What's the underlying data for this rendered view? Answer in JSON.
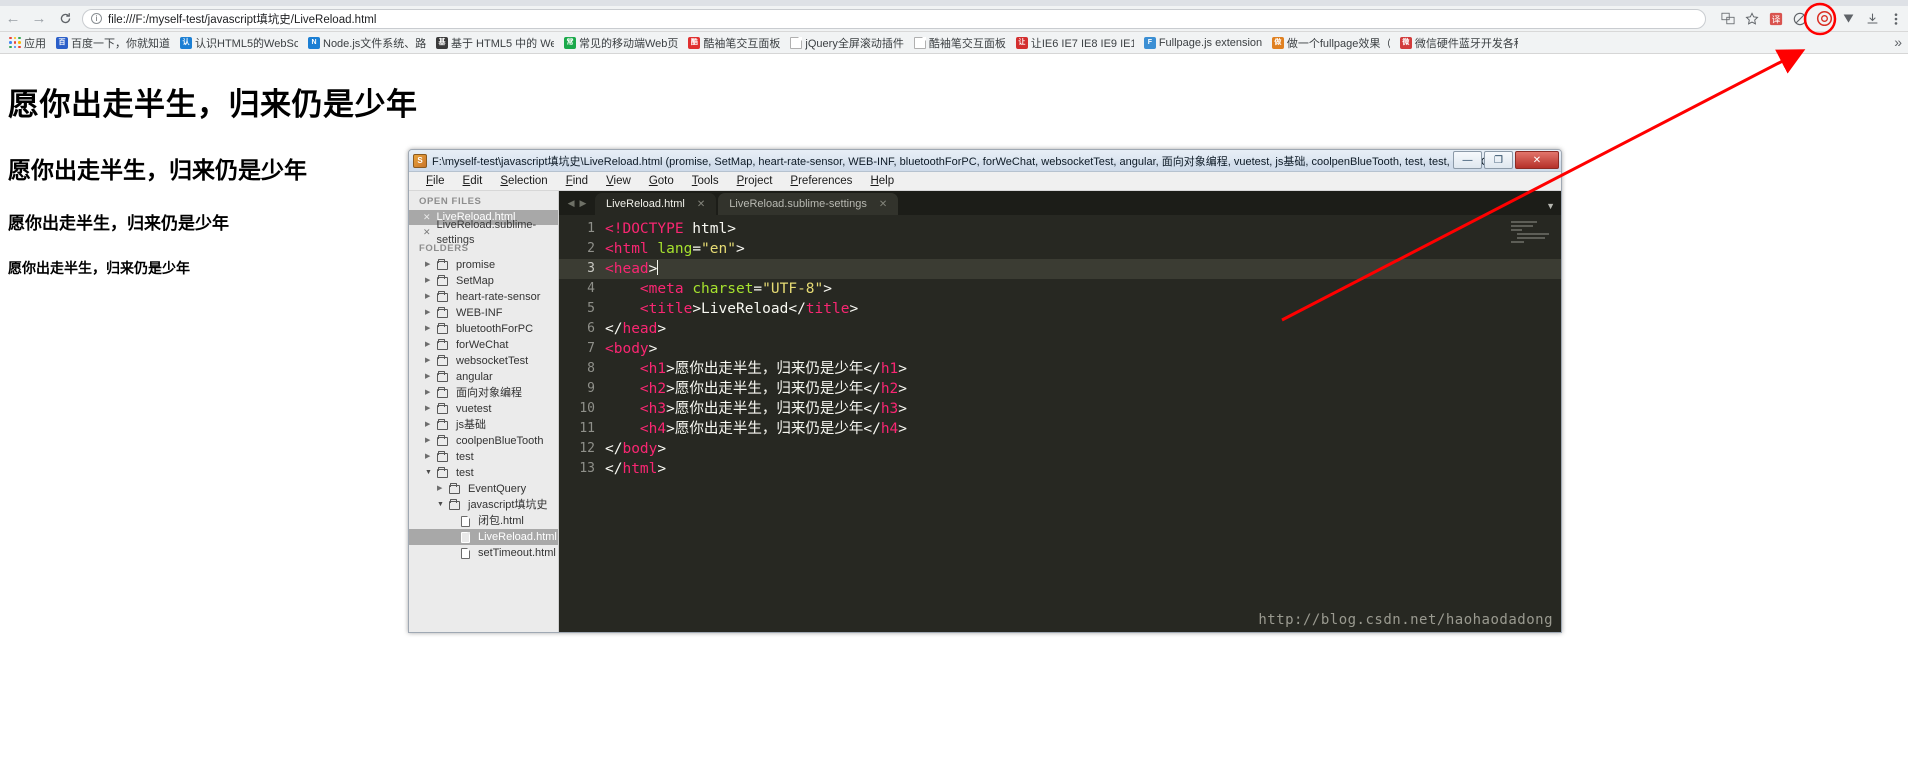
{
  "browser": {
    "back_icon": "←",
    "forward_icon": "→",
    "reload_icon": "C",
    "url": "file:///F:/myself-test/javascript填坑史/LiveReload.html",
    "info_icon": "i",
    "toolbar_icons": [
      "translate-icon",
      "star-icon",
      "extension-icon",
      "adblock-icon",
      "circle-icon",
      "lastpass-icon",
      "download-icon",
      "menu-icon"
    ],
    "overflow_label": "»"
  },
  "bookmarks": [
    {
      "label": "应用",
      "icon": "apps-grid-icon",
      "color": "#4285f4"
    },
    {
      "label": "百度一下，你就知道",
      "icon": "baidu-icon",
      "color": "#2b5fc9"
    },
    {
      "label": "认识HTML5的WebSc",
      "icon": "csdn-icon",
      "color": "#1b7fd4"
    },
    {
      "label": "Node.js文件系统、路",
      "icon": "csdn-icon",
      "color": "#1b7fd4"
    },
    {
      "label": "基于 HTML5 中的 We",
      "icon": "nav-icon",
      "color": "#3b3b3b"
    },
    {
      "label": "常见的移动端Web页",
      "icon": "c-green-icon",
      "color": "#1aa94a"
    },
    {
      "label": "酷袖笔交互面板",
      "icon": "b-red-icon",
      "color": "#e03030"
    },
    {
      "label": "jQuery全屏滚动插件",
      "icon": "page-icon",
      "color": "#ffffff"
    },
    {
      "label": "酷袖笔交互面板",
      "icon": "page-icon",
      "color": "#ffffff"
    },
    {
      "label": "让IE6 IE7 IE8 IE9 IE1",
      "icon": "c-red-icon",
      "color": "#d32f2f"
    },
    {
      "label": "Fullpage.js extension",
      "icon": "fullpage-icon",
      "color": "#3b8fd4"
    },
    {
      "label": "做一个fullpage效果（",
      "icon": "home-orange-icon",
      "color": "#e08020"
    },
    {
      "label": "微信硬件蓝牙开发各种",
      "icon": "wechat-dev-icon",
      "color": "#d23b3b"
    }
  ],
  "page": {
    "h1": "愿你出走半生，归来仍是少年",
    "h2": "愿你出走半生，归来仍是少年",
    "h3": "愿你出走半生，归来仍是少年",
    "h4": "愿你出走半生，归来仍是少年"
  },
  "sublime": {
    "title": "F:\\myself-test\\javascript填坑史\\LiveReload.html (promise, SetMap, heart-rate-sensor, WEB-INF, bluetoothForPC, forWeChat, websocketTest, angular, 面向对象编程, vuetest, js基础, coolpenBlueTooth, test, test, EventQuery, ...",
    "app_icon": "sublime-text-icon",
    "window_buttons": {
      "minimize": "—",
      "maximize": "❐",
      "close": "✕"
    },
    "menu": [
      "File",
      "Edit",
      "Selection",
      "Find",
      "View",
      "Goto",
      "Tools",
      "Project",
      "Preferences",
      "Help"
    ],
    "sidebar": {
      "open_files_header": "OPEN FILES",
      "open_files": [
        {
          "name": "LiveReload.html",
          "selected": true
        },
        {
          "name": "LiveReload.sublime-settings",
          "selected": false
        }
      ],
      "folders_header": "FOLDERS",
      "tree": [
        {
          "name": "promise",
          "type": "folder",
          "open": false,
          "depth": 1
        },
        {
          "name": "SetMap",
          "type": "folder",
          "open": false,
          "depth": 1
        },
        {
          "name": "heart-rate-sensor",
          "type": "folder",
          "open": false,
          "depth": 1
        },
        {
          "name": "WEB-INF",
          "type": "folder",
          "open": false,
          "depth": 1
        },
        {
          "name": "bluetoothForPC",
          "type": "folder",
          "open": false,
          "depth": 1
        },
        {
          "name": "forWeChat",
          "type": "folder",
          "open": false,
          "depth": 1
        },
        {
          "name": "websocketTest",
          "type": "folder",
          "open": false,
          "depth": 1
        },
        {
          "name": "angular",
          "type": "folder",
          "open": false,
          "depth": 1
        },
        {
          "name": "面向对象编程",
          "type": "folder",
          "open": false,
          "depth": 1
        },
        {
          "name": "vuetest",
          "type": "folder",
          "open": false,
          "depth": 1
        },
        {
          "name": "js基础",
          "type": "folder",
          "open": false,
          "depth": 1
        },
        {
          "name": "coolpenBlueTooth",
          "type": "folder",
          "open": false,
          "depth": 1
        },
        {
          "name": "test",
          "type": "folder",
          "open": false,
          "depth": 1
        },
        {
          "name": "test",
          "type": "folder",
          "open": true,
          "depth": 1
        },
        {
          "name": "EventQuery",
          "type": "folder",
          "open": false,
          "depth": 2
        },
        {
          "name": "javascript填坑史",
          "type": "folder",
          "open": true,
          "depth": 2
        },
        {
          "name": "闭包.html",
          "type": "file",
          "depth": 3,
          "selected": false
        },
        {
          "name": "LiveReload.html",
          "type": "file",
          "depth": 3,
          "selected": true
        },
        {
          "name": "setTimeout.html",
          "type": "file",
          "depth": 3,
          "selected": false
        }
      ]
    },
    "tabs": [
      {
        "label": "LiveReload.html",
        "active": true,
        "close_icon": "✕"
      },
      {
        "label": "LiveReload.sublime-settings",
        "active": false,
        "close_icon": "✕"
      }
    ],
    "tab_nav": {
      "prev": "◀",
      "next": "▶",
      "dropdown": "▼"
    },
    "code": [
      {
        "n": "1",
        "current": false,
        "tokens": [
          {
            "t": "<!DOCTYPE",
            "c": "tag"
          },
          {
            "t": " html>",
            "c": "ctext"
          }
        ]
      },
      {
        "n": "2",
        "current": false,
        "tokens": [
          {
            "t": "<html",
            "c": "tag"
          },
          {
            "t": " ",
            "c": "ctext"
          },
          {
            "t": "lang",
            "c": "attr"
          },
          {
            "t": "=",
            "c": "ctext"
          },
          {
            "t": "\"en\"",
            "c": "str"
          },
          {
            "t": ">",
            "c": "ctext"
          }
        ]
      },
      {
        "n": "3",
        "current": true,
        "tokens": [
          {
            "t": "<head",
            "c": "tag"
          },
          {
            "t": ">",
            "c": "ctext"
          }
        ]
      },
      {
        "n": "4",
        "current": false,
        "tokens": [
          {
            "t": "    ",
            "c": "ctext"
          },
          {
            "t": "<meta",
            "c": "tag"
          },
          {
            "t": " ",
            "c": "ctext"
          },
          {
            "t": "charset",
            "c": "attr"
          },
          {
            "t": "=",
            "c": "ctext"
          },
          {
            "t": "\"UTF-8\"",
            "c": "str"
          },
          {
            "t": ">",
            "c": "ctext"
          }
        ]
      },
      {
        "n": "5",
        "current": false,
        "tokens": [
          {
            "t": "    ",
            "c": "ctext"
          },
          {
            "t": "<title",
            "c": "tag"
          },
          {
            "t": ">",
            "c": "ctext"
          },
          {
            "t": "LiveReload",
            "c": "ctext"
          },
          {
            "t": "</",
            "c": "ctext"
          },
          {
            "t": "title",
            "c": "tag"
          },
          {
            "t": ">",
            "c": "ctext"
          }
        ]
      },
      {
        "n": "6",
        "current": false,
        "tokens": [
          {
            "t": "</",
            "c": "ctext"
          },
          {
            "t": "head",
            "c": "tag"
          },
          {
            "t": ">",
            "c": "ctext"
          }
        ]
      },
      {
        "n": "7",
        "current": false,
        "tokens": [
          {
            "t": "<body",
            "c": "tag"
          },
          {
            "t": ">",
            "c": "ctext"
          }
        ]
      },
      {
        "n": "8",
        "current": false,
        "tokens": [
          {
            "t": "    ",
            "c": "ctext"
          },
          {
            "t": "<h1",
            "c": "tag"
          },
          {
            "t": ">",
            "c": "ctext"
          },
          {
            "t": "愿你出走半生，归来仍是少年",
            "c": "ctext"
          },
          {
            "t": "</",
            "c": "ctext"
          },
          {
            "t": "h1",
            "c": "tag"
          },
          {
            "t": ">",
            "c": "ctext"
          }
        ]
      },
      {
        "n": "9",
        "current": false,
        "tokens": [
          {
            "t": "    ",
            "c": "ctext"
          },
          {
            "t": "<h2",
            "c": "tag"
          },
          {
            "t": ">",
            "c": "ctext"
          },
          {
            "t": "愿你出走半生，归来仍是少年",
            "c": "ctext"
          },
          {
            "t": "</",
            "c": "ctext"
          },
          {
            "t": "h2",
            "c": "tag"
          },
          {
            "t": ">",
            "c": "ctext"
          }
        ]
      },
      {
        "n": "10",
        "current": false,
        "tokens": [
          {
            "t": "    ",
            "c": "ctext"
          },
          {
            "t": "<h3",
            "c": "tag"
          },
          {
            "t": ">",
            "c": "ctext"
          },
          {
            "t": "愿你出走半生，归来仍是少年",
            "c": "ctext"
          },
          {
            "t": "</",
            "c": "ctext"
          },
          {
            "t": "h3",
            "c": "tag"
          },
          {
            "t": ">",
            "c": "ctext"
          }
        ]
      },
      {
        "n": "11",
        "current": false,
        "tokens": [
          {
            "t": "    ",
            "c": "ctext"
          },
          {
            "t": "<h4",
            "c": "tag"
          },
          {
            "t": ">",
            "c": "ctext"
          },
          {
            "t": "愿你出走半生，归来仍是少年",
            "c": "ctext"
          },
          {
            "t": "</",
            "c": "ctext"
          },
          {
            "t": "h4",
            "c": "tag"
          },
          {
            "t": ">",
            "c": "ctext"
          }
        ]
      },
      {
        "n": "12",
        "current": false,
        "tokens": [
          {
            "t": "</",
            "c": "ctext"
          },
          {
            "t": "body",
            "c": "tag"
          },
          {
            "t": ">",
            "c": "ctext"
          }
        ]
      },
      {
        "n": "13",
        "current": false,
        "tokens": [
          {
            "t": "</",
            "c": "ctext"
          },
          {
            "t": "html",
            "c": "tag"
          },
          {
            "t": ">",
            "c": "ctext"
          }
        ]
      }
    ],
    "watermark": "http://blog.csdn.net/haohaodadong"
  },
  "annotation": {
    "color": "#ff0000",
    "target": "browser-extension-icon"
  }
}
